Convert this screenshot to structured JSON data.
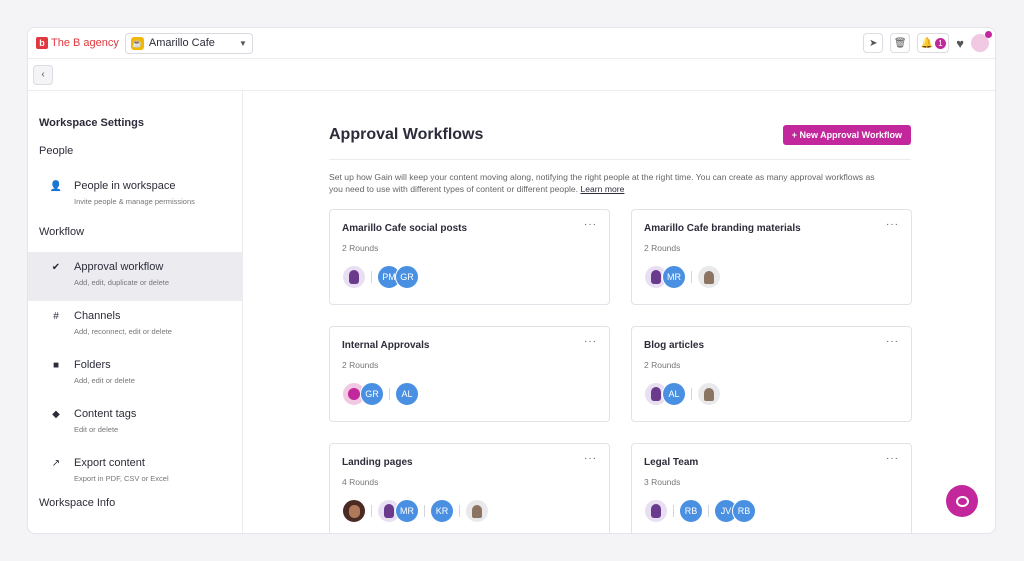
{
  "topbar": {
    "brand_logo": "b",
    "brand_name": "The B agency",
    "workspace": "Amarillo Cafe",
    "notifications_count": "1"
  },
  "sidebar": {
    "title": "Workspace Settings",
    "section_people": "People",
    "section_workflow": "Workflow",
    "section_info": "Workspace Info",
    "items": [
      {
        "label": "People in workspace",
        "desc": "Invite people & manage permissions",
        "icon": "person-icon"
      },
      {
        "label": "Approval workflow",
        "desc": "Add, edit, duplicate or delete",
        "icon": "check-circle-icon"
      },
      {
        "label": "Channels",
        "desc": "Add, reconnect, edit or delete",
        "icon": "hash-icon"
      },
      {
        "label": "Folders",
        "desc": "Add, edit or delete",
        "icon": "folder-icon"
      },
      {
        "label": "Content tags",
        "desc": "Edit or delete",
        "icon": "tag-icon"
      },
      {
        "label": "Export content",
        "desc": "Export in PDF, CSV or Excel",
        "icon": "export-icon"
      }
    ]
  },
  "main": {
    "title": "Approval Workflows",
    "new_button": "+ New Approval Workflow",
    "intro": "Set up how Gain will keep your content moving along, notifying the right people at the right time. You can create as many approval workflows as you need to use with different types of content or different people.",
    "learn_more": "Learn more",
    "cards": [
      {
        "title": "Amarillo Cafe social posts",
        "rounds": "2 Rounds",
        "avatars": [
          "PM",
          "GR"
        ]
      },
      {
        "title": "Amarillo Cafe branding materials",
        "rounds": "2 Rounds",
        "avatars": [
          "MR"
        ]
      },
      {
        "title": "Internal Approvals",
        "rounds": "2 Rounds",
        "avatars": [
          "GR",
          "AL"
        ]
      },
      {
        "title": "Blog articles",
        "rounds": "2 Rounds",
        "avatars": [
          "AL"
        ]
      },
      {
        "title": "Landing pages",
        "rounds": "4 Rounds",
        "avatars": [
          "MR",
          "KR"
        ]
      },
      {
        "title": "Legal Team",
        "rounds": "3 Rounds",
        "avatars": [
          "RB",
          "JV",
          "RB"
        ]
      }
    ]
  },
  "colors": {
    "accent": "#c2279b",
    "avatar_blue": "#4a90e2",
    "brand_red": "#e0383e"
  }
}
